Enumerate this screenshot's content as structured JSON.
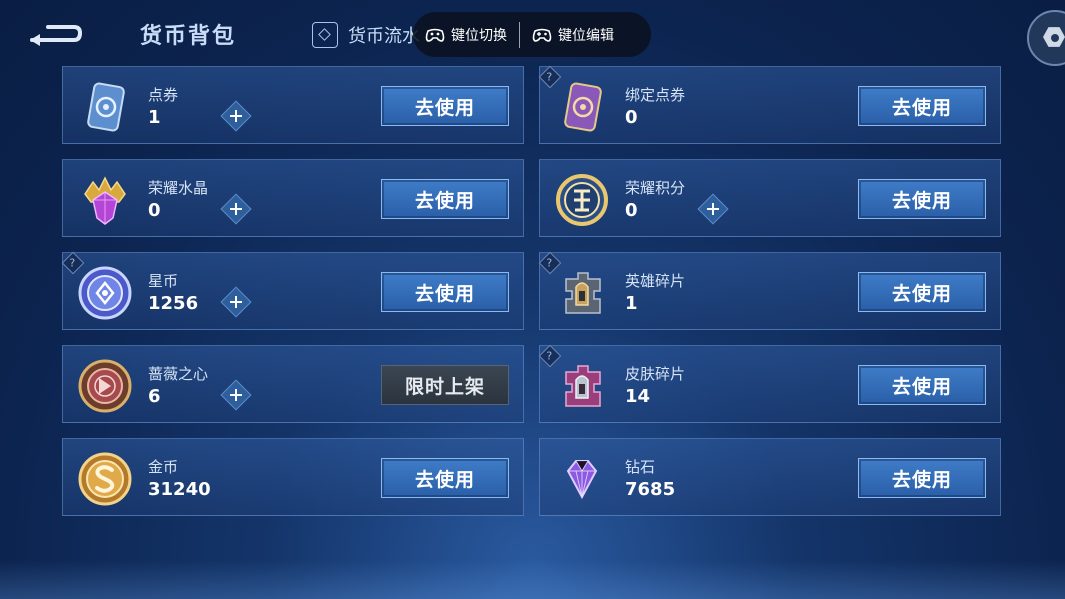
{
  "header": {
    "title": "货币背包",
    "flow_tab_label": "货币流水",
    "key_switch_label": "键位切换",
    "key_edit_label": "键位编辑"
  },
  "currencies": [
    {
      "name": "点券",
      "amount": "1",
      "action": "去使用"
    },
    {
      "name": "绑定点券",
      "amount": "0",
      "action": "去使用"
    },
    {
      "name": "荣耀水晶",
      "amount": "0",
      "action": "去使用"
    },
    {
      "name": "荣耀积分",
      "amount": "0",
      "action": "去使用"
    },
    {
      "name": "星币",
      "amount": "1256",
      "action": "去使用"
    },
    {
      "name": "英雄碎片",
      "amount": "1",
      "action": "去使用"
    },
    {
      "name": "蔷薇之心",
      "amount": "6",
      "action": "限时上架"
    },
    {
      "name": "皮肤碎片",
      "amount": "14",
      "action": "去使用"
    },
    {
      "name": "金币",
      "amount": "31240",
      "action": "去使用"
    },
    {
      "name": "钻石",
      "amount": "7685",
      "action": "去使用"
    }
  ],
  "help_mark": "?",
  "colors": {
    "accent_button": "#3f7cc8",
    "disabled_button": "#3b4652",
    "panel_border": "#78a5e1"
  }
}
